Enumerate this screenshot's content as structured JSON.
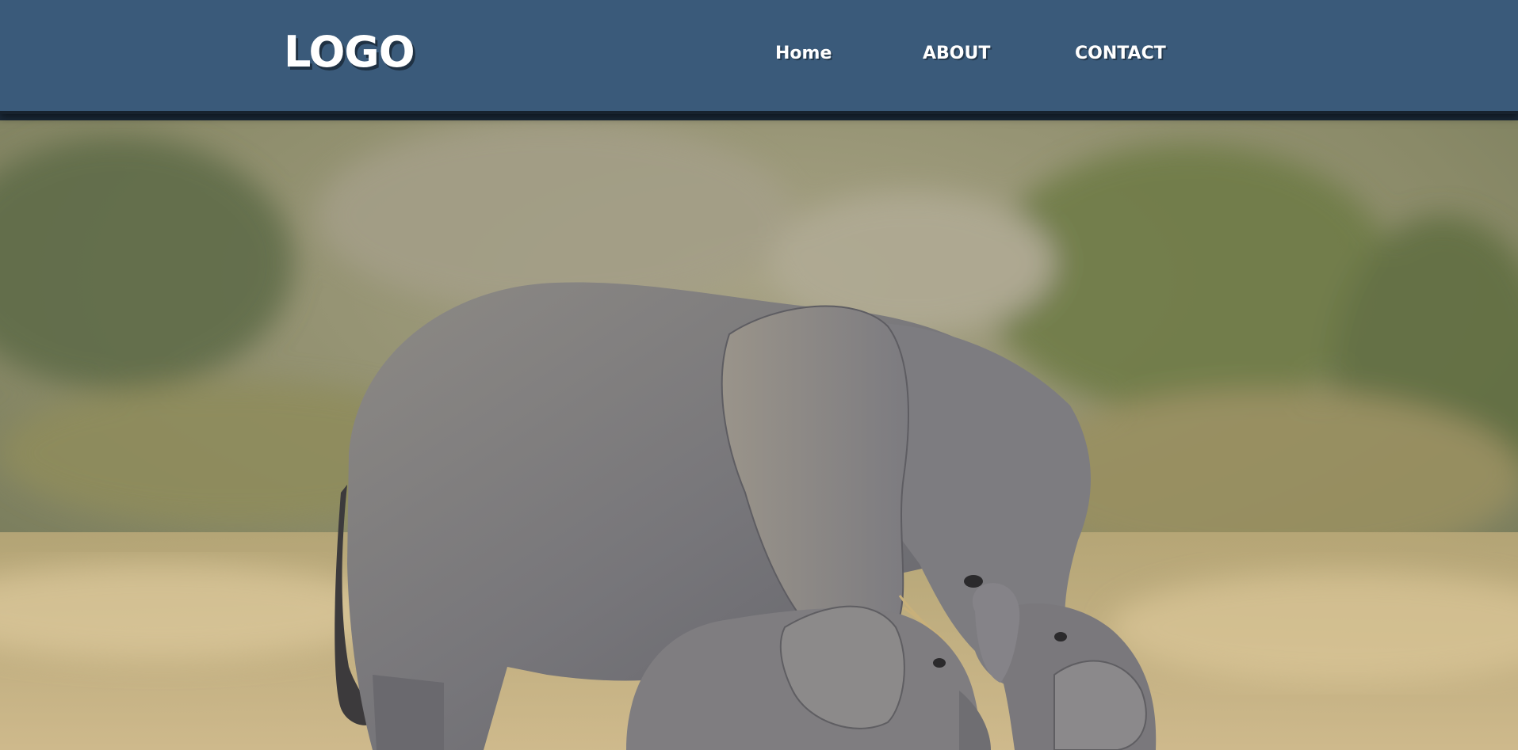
{
  "header": {
    "logo_text": "LOGO",
    "nav": [
      {
        "label": "Home"
      },
      {
        "label": "ABOUT"
      },
      {
        "label": "CONTACT"
      }
    ],
    "background_color": "#3a5a7a"
  },
  "hero": {
    "image_subject": "elephant-family-photo"
  }
}
